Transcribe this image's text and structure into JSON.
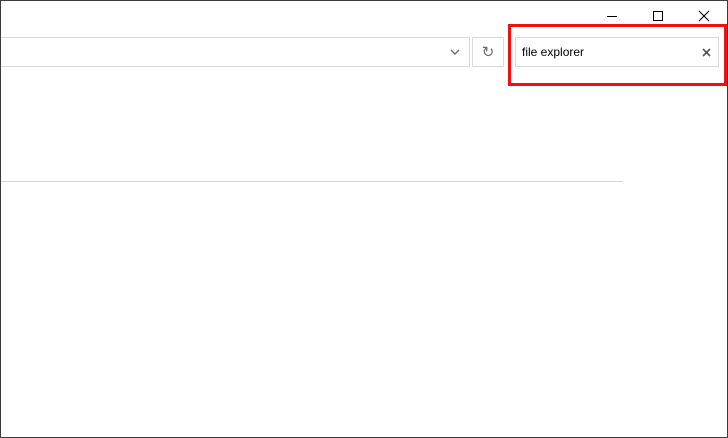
{
  "window": {
    "controls": {
      "minimize_icon": "minimize-icon",
      "maximize_icon": "maximize-icon",
      "close_icon": "close-icon"
    }
  },
  "address_bar": {
    "value": "",
    "dropdown_icon": "chevron-down-icon",
    "refresh_icon": "refresh-icon",
    "refresh_glyph": "↻"
  },
  "search": {
    "value": "file explorer",
    "clear_icon": "clear-icon"
  },
  "colors": {
    "highlight": "#ee1111",
    "border": "#d9d9d9"
  }
}
